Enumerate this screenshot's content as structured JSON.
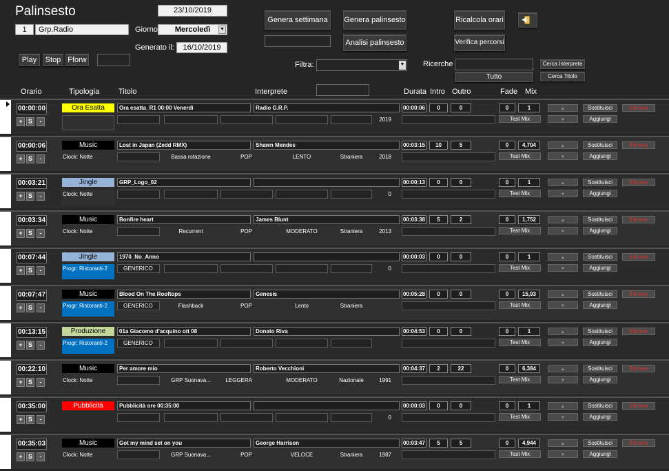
{
  "header": {
    "title": "Palinsesto",
    "date": "23/10/2019",
    "radio_num": "1",
    "radio_name": "Grp.Radio",
    "giorno_label": "Giorno",
    "giorno_value": "Mercoledì",
    "generato_label": "Generato il:",
    "generato_value": "16/10/2019",
    "genera_settimana": "Genera settimana",
    "genera_palinsesto": "Genera palinsesto",
    "analisi_palinsesto": "Analisi palinsesto",
    "ricalcola_orari": "Ricalcola orari",
    "verifica_percorsi": "Verifica percorsi",
    "play": "Play",
    "stop": "Stop",
    "fforw": "Fforw",
    "filtra_label": "Filtra:",
    "ricerche_label": "Ricerche",
    "tutto": "Tutto",
    "cerca_interprete": "Cerca Interprete",
    "cerca_titolo": "Cerca Titolo"
  },
  "columns": {
    "orario": "Orario",
    "tipologia": "Tipologia",
    "titolo": "Titolo",
    "interprete": "Interprete",
    "durata": "Durata",
    "intro": "Intro",
    "outro": "Outro",
    "fade": "Fade",
    "mix": "Mix"
  },
  "row_buttons": {
    "plus": "+",
    "s": "S",
    "minus": "-",
    "test_mix": "Test Mix",
    "sostituisci": "Sostituisci",
    "aggiungi": "Aggiungi",
    "elimina": "Elimina"
  },
  "rows": [
    {
      "time": "00:00:00",
      "tipo": "Ora Esatta",
      "tipo_bg": "#ffff00",
      "tipo_fg": "#000000",
      "clock": "",
      "clock_bg": "#303030",
      "titolo": "Ora esatta_R1 00:00 Venerdì",
      "interprete": "Radio G.R.P.",
      "s1": "",
      "s2": "",
      "s3": "",
      "s4": "",
      "year": "2019",
      "durata": "00:00:06",
      "intro": "0",
      "outro": "0",
      "fade": "0",
      "mix": "1",
      "genere_box": ""
    },
    {
      "time": "00:00:06",
      "tipo": "Music",
      "tipo_bg": "#000000",
      "tipo_fg": "#ffffff",
      "clock": "Clock: Notte",
      "clock_bg": "",
      "titolo": "Lost in Japan (Zedd RMX)",
      "interprete": "Shawn Mendes",
      "s1": "Bassa rotazione",
      "s2": "POP",
      "s3": "LENTO",
      "s4": "Straniera",
      "year": "2018",
      "durata": "00:03:15",
      "intro": "10",
      "outro": "5",
      "fade": "0",
      "mix": "4,704",
      "genere_box": ""
    },
    {
      "time": "00:03:21",
      "tipo": "Jingle",
      "tipo_bg": "#95b3d7",
      "tipo_fg": "#000000",
      "clock": "Clock: Notte",
      "clock_bg": "#303030",
      "titolo": "GRP_Logo_02",
      "interprete": "",
      "s1": "",
      "s2": "",
      "s3": "",
      "s4": "",
      "year": "0",
      "durata": "00:00:13",
      "intro": "0",
      "outro": "0",
      "fade": "0",
      "mix": "1",
      "genere_box": ""
    },
    {
      "time": "00:03:34",
      "tipo": "Music",
      "tipo_bg": "#000000",
      "tipo_fg": "#ffffff",
      "clock": "Clock: Notte",
      "clock_bg": "",
      "titolo": "Bonfire heart",
      "interprete": "James Blunt",
      "s1": "Recurrent",
      "s2": "POP",
      "s3": "MODERATO",
      "s4": "Straniera",
      "year": "2013",
      "durata": "00:03:38",
      "intro": "5",
      "outro": "2",
      "fade": "0",
      "mix": "1,752",
      "genere_box": ""
    },
    {
      "time": "00:07:44",
      "tipo": "Jingle",
      "tipo_bg": "#95b3d7",
      "tipo_fg": "#000000",
      "clock": "Progr: Ristoranti-2",
      "clock_bg": "#0070c0",
      "titolo": "1970_No_Anno",
      "interprete": "",
      "s1": "",
      "s2": "",
      "s3": "",
      "s4": "",
      "year": "0",
      "durata": "00:00:03",
      "intro": "0",
      "outro": "0",
      "fade": "0",
      "mix": "1",
      "genere_box": "GENERICO"
    },
    {
      "time": "00:07:47",
      "tipo": "Music",
      "tipo_bg": "#000000",
      "tipo_fg": "#ffffff",
      "clock": "Progr: Ristoranti-2",
      "clock_bg": "#0070c0",
      "titolo": "Blood On The Rooftops",
      "interprete": "Genesis",
      "s1": "Flashback",
      "s2": "POP",
      "s3": "Lento",
      "s4": "Straniera",
      "year": "",
      "durata": "00:05:28",
      "intro": "0",
      "outro": "0",
      "fade": "0",
      "mix": "15,93",
      "genere_box": "GENERICO"
    },
    {
      "time": "00:13:15",
      "tipo": "Produzione",
      "tipo_bg": "#c4d79b",
      "tipo_fg": "#000000",
      "clock": "Progr: Ristoranti-2",
      "clock_bg": "#0070c0",
      "titolo": "01a Giacomo d'acquino ott 08",
      "interprete": "Donato Riva",
      "s1": "",
      "s2": "",
      "s3": "",
      "s4": "",
      "year": "",
      "durata": "00:04:53",
      "intro": "0",
      "outro": "0",
      "fade": "0",
      "mix": "1",
      "genere_box": "GENERICO"
    },
    {
      "time": "00:22:10",
      "tipo": "Music",
      "tipo_bg": "#000000",
      "tipo_fg": "#ffffff",
      "clock": "Clock: Notte",
      "clock_bg": "",
      "titolo": "Per amore mio",
      "interprete": "Roberto Vecchioni",
      "s1": "GRP Suonava...",
      "s2": "LEGGERA",
      "s3": "MODERATO",
      "s4": "Nazionale",
      "year": "1991",
      "durata": "00:04:37",
      "intro": "2",
      "outro": "22",
      "fade": "0",
      "mix": "6,384",
      "genere_box": ""
    },
    {
      "time": "00:35:00",
      "tipo": "Pubblicità",
      "tipo_bg": "#ff0000",
      "tipo_fg": "#ffffff",
      "clock": "",
      "clock_bg": "",
      "titolo": "Pubblicità ore 00:35:00",
      "interprete": "",
      "s1": "",
      "s2": "",
      "s3": "",
      "s4": "",
      "year": "0",
      "durata": "00:00:03",
      "intro": "0",
      "outro": "0",
      "fade": "0",
      "mix": "1",
      "genere_box": ""
    },
    {
      "time": "00:35:03",
      "tipo": "Music",
      "tipo_bg": "#000000",
      "tipo_fg": "#ffffff",
      "clock": "Clock: Notte",
      "clock_bg": "",
      "titolo": "Got my mind set on you",
      "interprete": "George Harrison",
      "s1": "GRP Suonava...",
      "s2": "POP",
      "s3": "VELOCE",
      "s4": "Straniera",
      "year": "1987",
      "durata": "00:03:47",
      "intro": "5",
      "outro": "5",
      "fade": "0",
      "mix": "4,944",
      "genere_box": ""
    }
  ]
}
